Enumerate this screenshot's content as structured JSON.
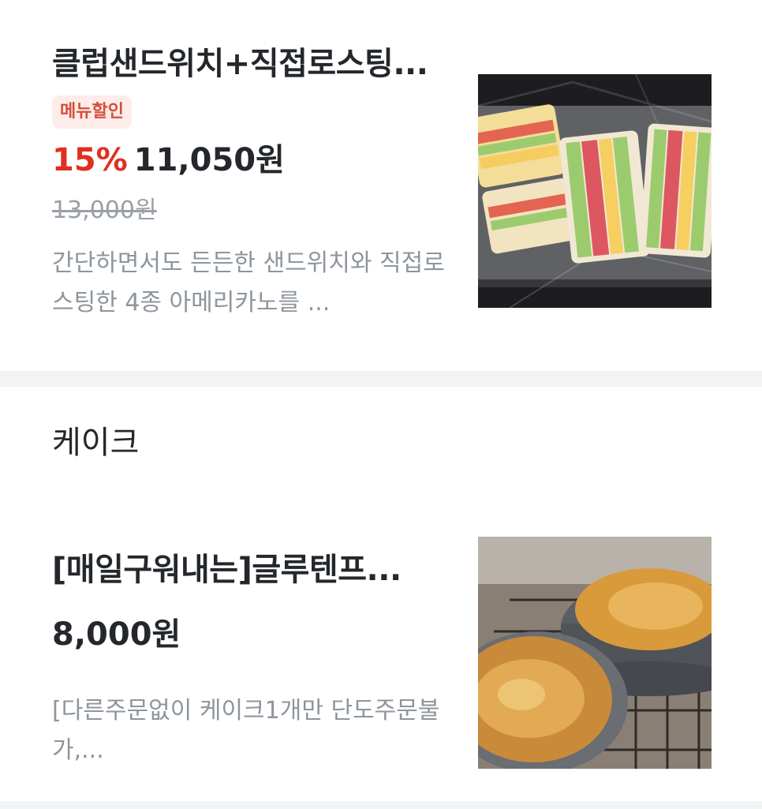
{
  "items": [
    {
      "title": "클럽샌드위치+직접로스팅...",
      "badge": "메뉴할인",
      "discount": "15%",
      "price": "11,050원",
      "original_price": "13,000원",
      "description": "간단하면서도 든든한 샌드위치와 직접로스팅한 4종 아메리카노를 ..."
    },
    {
      "title": "[매일구워내는]글루텐프...",
      "price": "8,000원",
      "description": "[다른주문없이 케이크1개만 단도주문불가,..."
    }
  ],
  "section": {
    "title": "케이크"
  }
}
